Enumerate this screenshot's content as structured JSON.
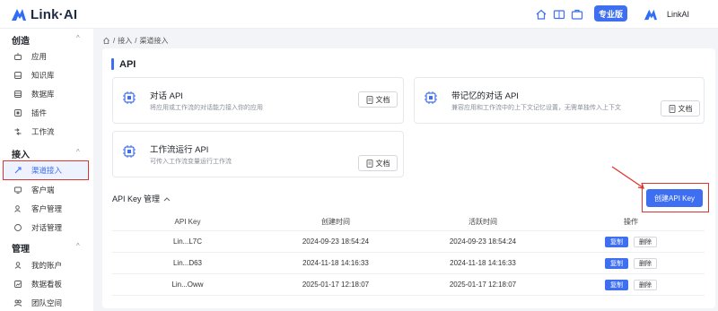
{
  "header": {
    "logo_text": "Link·AI",
    "pro_label": "专业版",
    "user_name": "LinkAI"
  },
  "sidebar": {
    "groups": [
      {
        "title": "创造",
        "items": [
          "应用",
          "知识库",
          "数据库",
          "插件",
          "工作流"
        ]
      },
      {
        "title": "接入",
        "items": [
          "渠道接入",
          "客户端",
          "客户管理",
          "对话管理"
        ]
      },
      {
        "title": "管理",
        "items": [
          "我的账户",
          "数据看板",
          "团队空间"
        ]
      }
    ],
    "active_item": "渠道接入"
  },
  "breadcrumb": {
    "items": [
      "接入",
      "渠道接入"
    ],
    "separator": "/"
  },
  "api_section": {
    "title": "API",
    "cards": [
      {
        "title": "对话 API",
        "desc": "将应用或工作流的对话能力接入你的应用",
        "doc_label": "文档"
      },
      {
        "title": "带记忆的对话 API",
        "desc": "兼容应用和工作流中的上下文记忆设置，无需单独传入上下文",
        "doc_label": "文档"
      },
      {
        "title": "工作流运行 API",
        "desc": "可传入工作流变量运行工作流",
        "doc_label": "文档"
      }
    ]
  },
  "apikey_section": {
    "title": "API Key 管理",
    "create_label": "创建API Key",
    "columns": [
      "API Key",
      "创建时间",
      "活跃时间",
      "操作"
    ],
    "rows": [
      {
        "key": "Lin...L7C",
        "created": "2024-09-23 18:54:24",
        "active": "2024-09-23 18:54:24"
      },
      {
        "key": "Lin...D63",
        "created": "2024-11-18 14:16:33",
        "active": "2024-11-18 14:16:33"
      },
      {
        "key": "Lin...Oww",
        "created": "2025-01-17 12:18:07",
        "active": "2025-01-17 12:18:07"
      }
    ],
    "copy_label": "复制",
    "delete_label": "删除"
  },
  "colors": {
    "accent": "#3d6ff0",
    "highlight": "#e0342e"
  }
}
